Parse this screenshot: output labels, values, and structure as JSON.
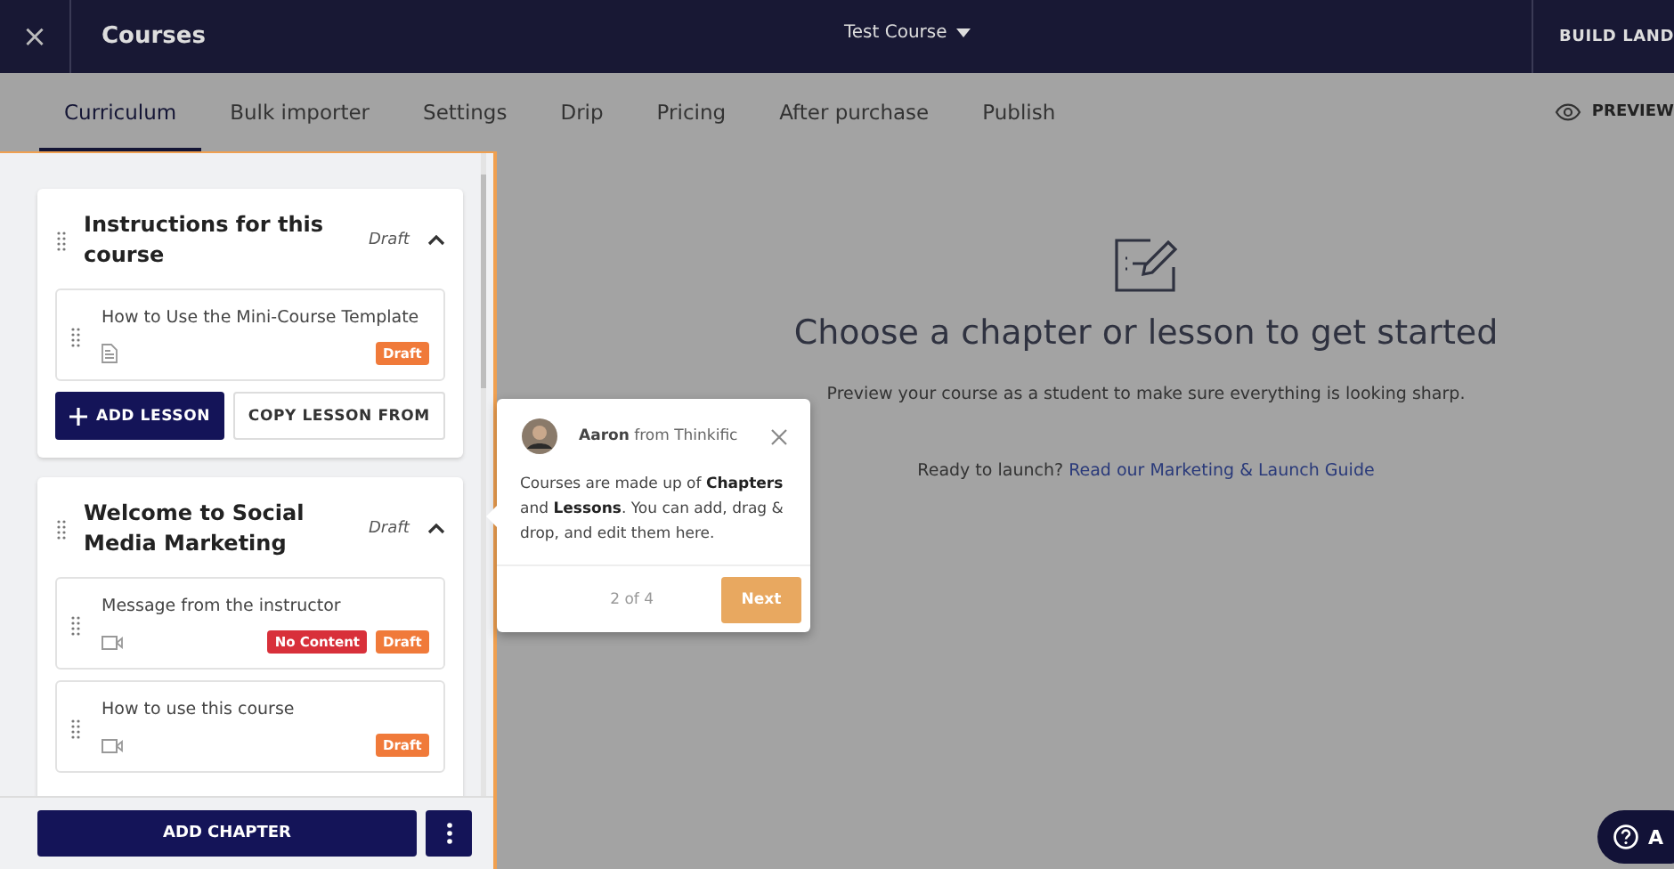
{
  "top_bar": {
    "close": "×",
    "title": "Courses",
    "course_menu": "Test Course",
    "right_button": "BUILD LAND"
  },
  "tabs": [
    {
      "label": "Curriculum",
      "selected": true
    },
    {
      "label": "Bulk importer",
      "selected": false
    },
    {
      "label": "Settings",
      "selected": false
    },
    {
      "label": "Drip",
      "selected": false
    },
    {
      "label": "Pricing",
      "selected": false
    },
    {
      "label": "After purchase",
      "selected": false
    },
    {
      "label": "Publish",
      "selected": false
    }
  ],
  "preview": "PREVIEW",
  "chapters": [
    {
      "title": "Instructions for this course",
      "status": "Draft",
      "expanded": true,
      "lessons": [
        {
          "title": "How to Use the Mini-Course Template",
          "kind": "text",
          "badges": [
            {
              "label": "Draft",
              "kind": "draft"
            }
          ]
        }
      ],
      "buttons": [
        {
          "label": "ADD LESSON",
          "kind": "primary"
        },
        {
          "label": "COPY LESSON FROM",
          "kind": "secondary"
        }
      ]
    },
    {
      "title": "Welcome to Social Media Marketing",
      "status": "Draft",
      "expanded": true,
      "lessons": [
        {
          "title": "Message from the instructor",
          "kind": "video",
          "badges": [
            {
              "label": "No Content",
              "kind": "error"
            },
            {
              "label": "Draft",
              "kind": "draft"
            }
          ]
        },
        {
          "title": "How to use this course",
          "kind": "video",
          "badges": [
            {
              "label": "Draft",
              "kind": "draft"
            }
          ]
        }
      ]
    }
  ],
  "add_chapter": "ADD CHAPTER",
  "main": {
    "heading": "Choose a chapter or lesson to get started",
    "subtext": "Preview your course as a student to make sure everything is looking sharp.",
    "launch_text": "Ready to launch?",
    "launch_link": "Read our Marketing & Launch Guide"
  },
  "tooltip": {
    "author": "Aaron",
    "author_suffix": "from Thinkific",
    "body": "Courses are made up of **Chapters** and **Lessons**. You can add, drag & drop, and edit them here.",
    "step": "2 of 4",
    "next": "Next"
  },
  "help_button": "A"
}
